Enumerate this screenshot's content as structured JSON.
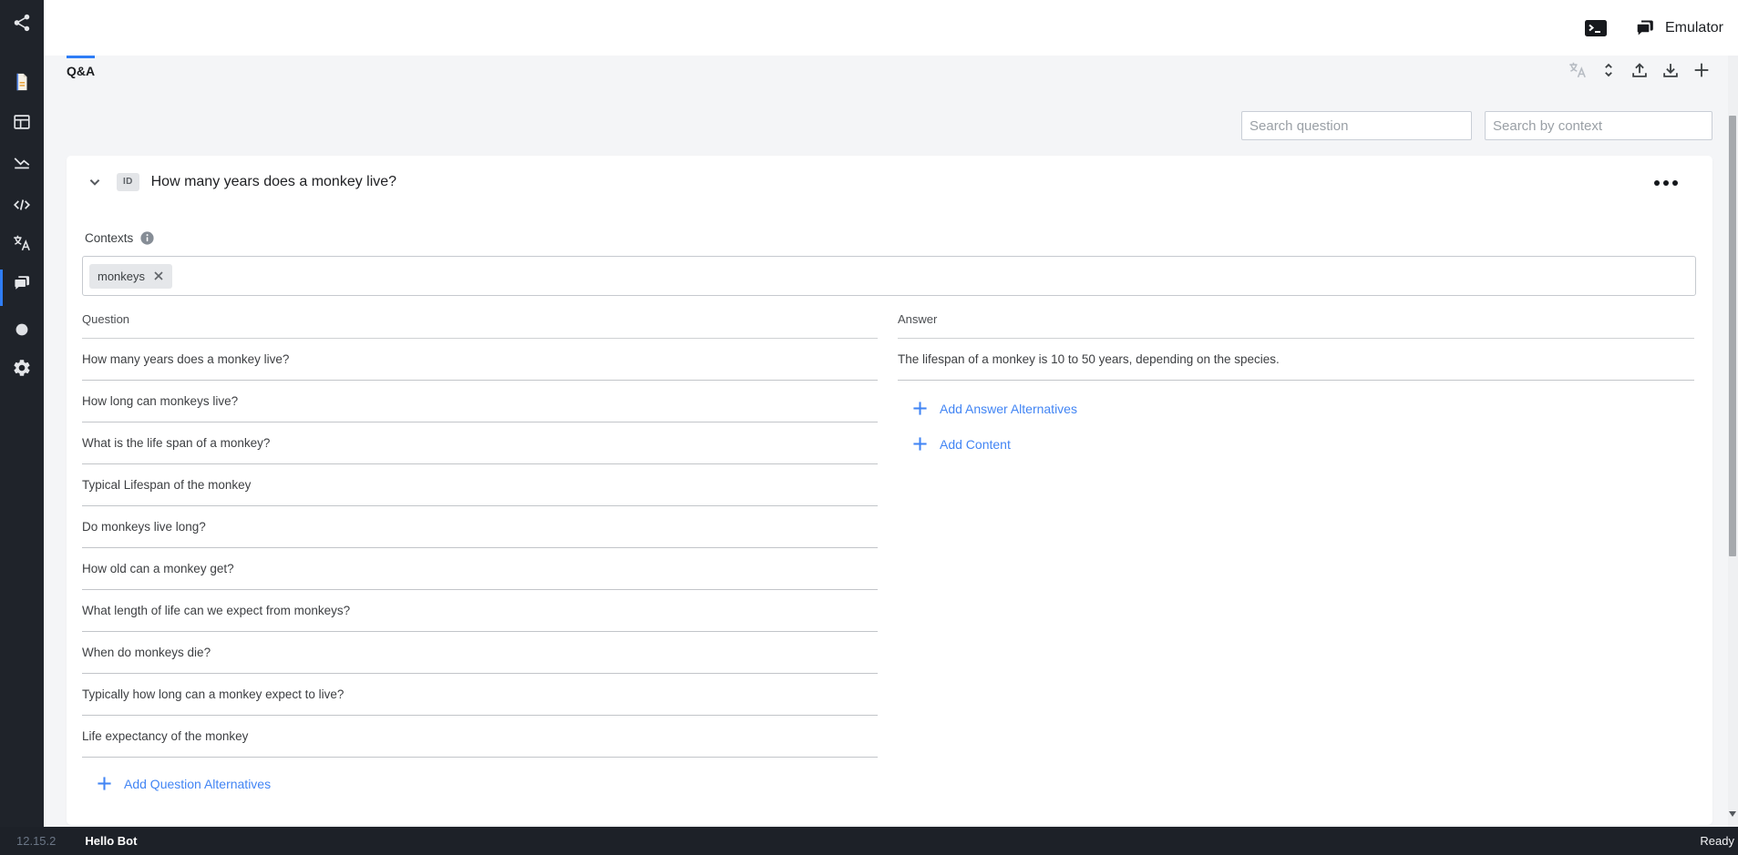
{
  "app": {
    "emulator_label": "Emulator",
    "version": "12.15.2",
    "bot_name": "Hello Bot",
    "status": "Ready"
  },
  "tab": {
    "label": "Q&A"
  },
  "sidebar": {
    "icons": [
      "share-icon",
      "form-document-icon",
      "dashboard-icon",
      "line-chart-icon",
      "code-icon",
      "translate-icon",
      "chat-icon-active",
      "circle-icon",
      "settings-gear-icon"
    ]
  },
  "toolbar": {
    "icons": [
      "translate-icon-disabled",
      "unfold-more-icon",
      "upload-icon",
      "download-icon",
      "add-icon"
    ]
  },
  "search": {
    "question_placeholder": "Search question",
    "context_placeholder": "Search by context"
  },
  "qna": {
    "id_badge": "ID",
    "title": "How many years does a monkey live?",
    "contexts_label": "Contexts",
    "context_tags": [
      "monkeys"
    ],
    "question_header": "Question",
    "answer_header": "Answer",
    "questions": [
      "How many years does a monkey live?",
      "How long can monkeys live?",
      "What is the life span of a monkey?",
      "Typical Lifespan of the monkey",
      "Do monkeys live long?",
      "How old can a monkey get?",
      "What length of life can we expect from monkeys?",
      "When do monkeys die?",
      "Typically how long can a monkey expect to live?",
      "Life expectancy of the monkey"
    ],
    "answer": "The lifespan of a monkey is 10 to 50 years, depending on the species.",
    "add_question_alternatives_label": "Add Question Alternatives",
    "add_answer_alternatives_label": "Add Answer Alternatives",
    "add_content_label": "Add Content"
  },
  "colors": {
    "accent": "#4285f4",
    "active_indicator": "#2f7df6",
    "sidebar_bg": "#1f232a"
  }
}
